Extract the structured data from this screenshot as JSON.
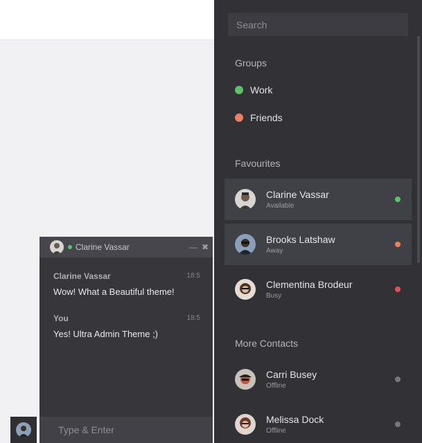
{
  "colors": {
    "online": "#5cc16b",
    "away": "#ee7f5e",
    "busy": "#e85152",
    "offline": "#77777d"
  },
  "sidebar": {
    "search_placeholder": "Search",
    "groups_title": "Groups",
    "groups": [
      {
        "label": "Work",
        "color": "#5cc16b"
      },
      {
        "label": "Friends",
        "color": "#ee7f5e"
      }
    ],
    "favourites_title": "Favourites",
    "favourites": [
      {
        "name": "Clarine Vassar",
        "status": "Available"
      },
      {
        "name": "Brooks Latshaw",
        "status": "Away"
      },
      {
        "name": "Clementina Brodeur",
        "status": "Busy"
      }
    ],
    "more_title": "More Contacts",
    "more": [
      {
        "name": "Carri Busey",
        "status": "Offline"
      },
      {
        "name": "Melissa Dock",
        "status": "Offline"
      }
    ]
  },
  "chat": {
    "contact_name": "Clarine Vassar",
    "minimize_icon": "minimize-icon",
    "close_icon": "close-icon",
    "messages": [
      {
        "from": "Clarine Vassar",
        "time": "18:5",
        "text": "Wow! What a Beautiful theme!"
      },
      {
        "from": "You",
        "time": "18:5",
        "text": "Yes! Ultra Admin Theme ;)"
      }
    ],
    "input_placeholder": "Type & Enter"
  }
}
